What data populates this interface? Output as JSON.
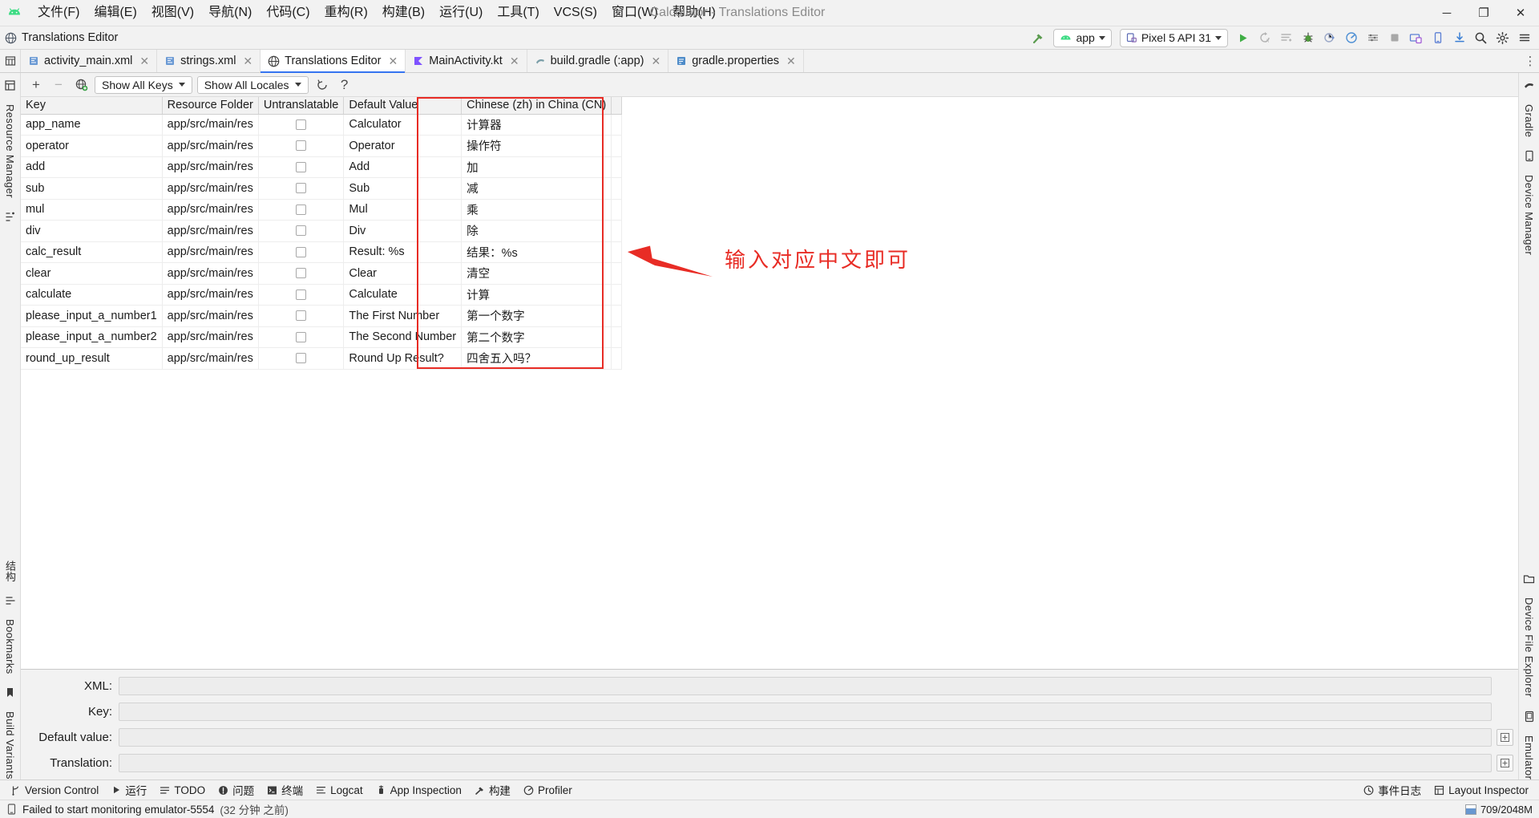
{
  "window": {
    "title": "Calculator - Translations Editor",
    "controls": {
      "minimize": "─",
      "maximize": "❐",
      "close": "✕"
    }
  },
  "menubar": {
    "logo": "android-studio-logo-icon",
    "items": [
      {
        "label": "文件(F)",
        "name": "menu-file"
      },
      {
        "label": "编辑(E)",
        "name": "menu-edit"
      },
      {
        "label": "视图(V)",
        "name": "menu-view"
      },
      {
        "label": "导航(N)",
        "name": "menu-navigate"
      },
      {
        "label": "代码(C)",
        "name": "menu-code"
      },
      {
        "label": "重构(R)",
        "name": "menu-refactor"
      },
      {
        "label": "构建(B)",
        "name": "menu-build"
      },
      {
        "label": "运行(U)",
        "name": "menu-run"
      },
      {
        "label": "工具(T)",
        "name": "menu-tools"
      },
      {
        "label": "VCS(S)",
        "name": "menu-vcs"
      },
      {
        "label": "窗口(W)",
        "name": "menu-window"
      },
      {
        "label": "帮助(H)",
        "name": "menu-help"
      }
    ]
  },
  "navbar": {
    "breadcrumb": "Translations Editor",
    "breadcrumb_icon": "translations-editor-icon",
    "run_config": "app",
    "run_config_icon": "android-app-icon",
    "device": "Pixel 5 API 31",
    "device_icon": "device-phone-icon",
    "right_icons": [
      "hammer-build-icon",
      "run-icon",
      "apply-changes-icon",
      "apply-code-changes-icon",
      "debug-icon",
      "attach-debugger-icon",
      "profile-icon",
      "device-explorer-icon",
      "stop-icon",
      "avd-manager-icon",
      "device-mirror-icon",
      "sdk-download-icon",
      "search-icon",
      "settings-gear-icon",
      "hamburger-menu-icon"
    ]
  },
  "tabs": [
    {
      "label": "activity_main.xml",
      "icon": "xml-layout-file-icon",
      "active": false,
      "closable": true
    },
    {
      "label": "strings.xml",
      "icon": "xml-values-file-icon",
      "active": false,
      "closable": true
    },
    {
      "label": "Translations Editor",
      "icon": "translations-editor-icon",
      "active": true,
      "closable": true
    },
    {
      "label": "MainActivity.kt",
      "icon": "kotlin-file-icon",
      "active": false,
      "closable": true
    },
    {
      "label": "build.gradle (:app)",
      "icon": "gradle-file-icon",
      "active": false,
      "closable": true
    },
    {
      "label": "gradle.properties",
      "icon": "properties-file-icon",
      "active": false,
      "closable": true
    }
  ],
  "left_stripe": [
    {
      "label": "Resource Manager",
      "name": "tool-resource-manager",
      "icon": "resource-manager-icon"
    },
    {
      "label": "结构",
      "name": "tool-structure",
      "icon": "structure-icon"
    },
    {
      "label": "Bookmarks",
      "name": "tool-bookmarks",
      "icon": "bookmarks-icon"
    },
    {
      "label": "Build Variants",
      "name": "tool-build-variants",
      "icon": "build-variants-icon"
    }
  ],
  "right_stripe": [
    {
      "label": "Gradle",
      "name": "tool-gradle",
      "icon": "gradle-elephant-icon"
    },
    {
      "label": "Device Manager",
      "name": "tool-device-manager",
      "icon": "device-manager-icon"
    },
    {
      "label": "Device File Explorer",
      "name": "tool-device-file-explorer",
      "icon": "folder-device-icon"
    },
    {
      "label": "Emulator",
      "name": "tool-emulator",
      "icon": "emulator-icon"
    }
  ],
  "te_toolbar": {
    "add_label": "+",
    "remove_label": "−",
    "add_locale_icon": "add-locale-globe-icon",
    "keys_filter": "Show All Keys",
    "locales_filter": "Show All Locales",
    "reload_icon": "reload-icon",
    "help_label": "?"
  },
  "table": {
    "columns": [
      "Key",
      "Resource Folder",
      "Untranslatable",
      "Default Value",
      "Chinese (zh) in China (CN)"
    ],
    "rows": [
      {
        "key": "app_name",
        "folder": "app/src/main/res",
        "untranslatable": false,
        "default": "Calculator",
        "zh": "计算器"
      },
      {
        "key": "operator",
        "folder": "app/src/main/res",
        "untranslatable": false,
        "default": "Operator",
        "zh": "操作符"
      },
      {
        "key": "add",
        "folder": "app/src/main/res",
        "untranslatable": false,
        "default": "Add",
        "zh": "加"
      },
      {
        "key": "sub",
        "folder": "app/src/main/res",
        "untranslatable": false,
        "default": "Sub",
        "zh": "减"
      },
      {
        "key": "mul",
        "folder": "app/src/main/res",
        "untranslatable": false,
        "default": "Mul",
        "zh": "乘"
      },
      {
        "key": "div",
        "folder": "app/src/main/res",
        "untranslatable": false,
        "default": "Div",
        "zh": "除"
      },
      {
        "key": "calc_result",
        "folder": "app/src/main/res",
        "untranslatable": false,
        "default": "Result: %s",
        "zh": "结果：%s"
      },
      {
        "key": "clear",
        "folder": "app/src/main/res",
        "untranslatable": false,
        "default": "Clear",
        "zh": "清空"
      },
      {
        "key": "calculate",
        "folder": "app/src/main/res",
        "untranslatable": false,
        "default": "Calculate",
        "zh": "计算"
      },
      {
        "key": "please_input_a_number1",
        "folder": "app/src/main/res",
        "untranslatable": false,
        "default": "The First Number",
        "zh": "第一个数字"
      },
      {
        "key": "please_input_a_number2",
        "folder": "app/src/main/res",
        "untranslatable": false,
        "default": "The Second Number",
        "zh": "第二个数字"
      },
      {
        "key": "round_up_result",
        "folder": "app/src/main/res",
        "untranslatable": false,
        "default": "Round Up Result?",
        "zh": "四舍五入吗？"
      }
    ]
  },
  "annotation": {
    "text": "输入对应中文即可",
    "color": "#e82c25",
    "arrow": "left-arrow-annotation"
  },
  "detail": {
    "fields": [
      {
        "label": "XML:",
        "value": "",
        "name": "xml-field",
        "button": false
      },
      {
        "label": "Key:",
        "value": "",
        "name": "key-field",
        "button": false
      },
      {
        "label": "Default value:",
        "value": "",
        "name": "default-value-field",
        "button": true
      },
      {
        "label": "Translation:",
        "value": "",
        "name": "translation-field",
        "button": true
      }
    ]
  },
  "toolwindow_bar": {
    "items": [
      {
        "label": "Version Control",
        "icon": "version-control-branch-icon",
        "name": "tw-version-control"
      },
      {
        "label": "运行",
        "icon": "run-play-icon",
        "name": "tw-run"
      },
      {
        "label": "TODO",
        "icon": "todo-list-icon",
        "name": "tw-todo"
      },
      {
        "label": "问题",
        "icon": "problems-warning-icon",
        "name": "tw-problems"
      },
      {
        "label": "终端",
        "icon": "terminal-icon",
        "name": "tw-terminal"
      },
      {
        "label": "Logcat",
        "icon": "logcat-icon",
        "name": "tw-logcat"
      },
      {
        "label": "App Inspection",
        "icon": "app-inspection-icon",
        "name": "tw-app-inspection"
      },
      {
        "label": "构建",
        "icon": "build-hammer-icon",
        "name": "tw-build"
      },
      {
        "label": "Profiler",
        "icon": "profiler-icon",
        "name": "tw-profiler"
      }
    ],
    "right_items": [
      {
        "label": "事件日志",
        "icon": "event-log-icon",
        "name": "tw-event-log"
      },
      {
        "label": "Layout Inspector",
        "icon": "layout-inspector-icon",
        "name": "tw-layout-inspector"
      }
    ]
  },
  "statusbar": {
    "icon": "device-notice-icon",
    "message": "Failed to start monitoring emulator-5554",
    "message_time": "(32 分钟 之前)",
    "memory": "709/2048M"
  }
}
